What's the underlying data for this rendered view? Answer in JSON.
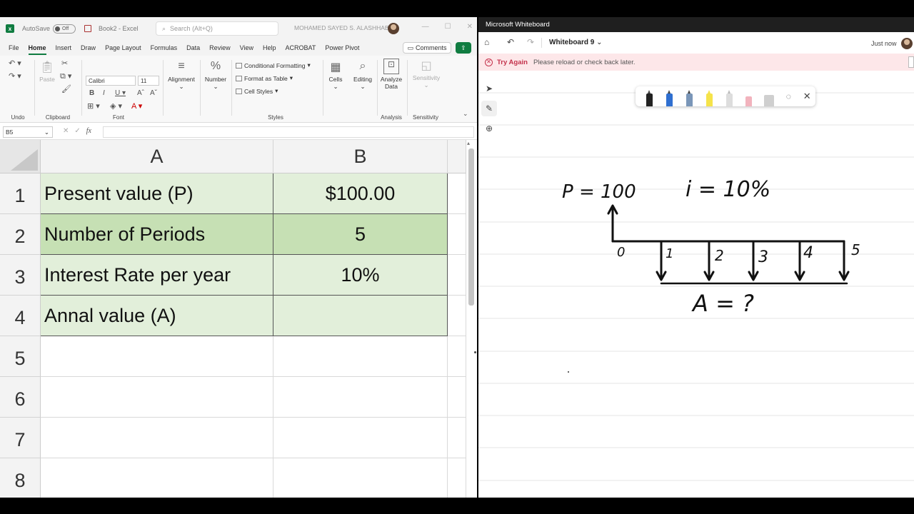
{
  "excel": {
    "autosave_label": "AutoSave",
    "autosave_state": "Off",
    "filename": "Book2  -  Excel",
    "search_placeholder": "Search (Alt+Q)",
    "user_name": "MOHAMED SAYED S. ALASHHAB",
    "tabs": [
      "File",
      "Home",
      "Insert",
      "Draw",
      "Page Layout",
      "Formulas",
      "Data",
      "Review",
      "View",
      "Help",
      "ACROBAT",
      "Power Pivot"
    ],
    "active_tab": "Home",
    "comments_label": "Comments",
    "ribbon": {
      "undo_label": "Undo",
      "paste_label": "Paste",
      "clipboard_label": "Clipboard",
      "font_name": "Calibri",
      "font_size": "11",
      "font_label": "Font",
      "alignment_label": "Alignment",
      "number_label": "Number",
      "conditional_formatting": "Conditional Formatting",
      "format_as_table": "Format as Table",
      "cell_styles": "Cell Styles",
      "styles_label": "Styles",
      "cells_label": "Cells",
      "editing_label": "Editing",
      "analyze_data_line1": "Analyze",
      "analyze_data_line2": "Data",
      "analysis_label": "Analysis",
      "sensitivity_btn": "Sensitivity",
      "sensitivity_label": "Sensitivity"
    },
    "name_box": "B5",
    "columns": [
      "A",
      "B"
    ],
    "rows": [
      "1",
      "2",
      "3",
      "4",
      "5",
      "6",
      "7",
      "8"
    ],
    "cells": [
      {
        "a": "Present value (P)",
        "b": "$100.00"
      },
      {
        "a": "Number of Periods",
        "b": "5"
      },
      {
        "a": "Interest Rate per year",
        "b": "10%"
      },
      {
        "a": "Annal value (A)",
        "b": ""
      }
    ],
    "colors": {
      "accent": "#107c41",
      "fill_light": "#e2efda",
      "fill_dark": "#c6e0b4"
    }
  },
  "whiteboard": {
    "app_title": "Microsoft Whiteboard",
    "board_name": "Whiteboard 9",
    "saved_status": "Just now",
    "error_title": "Try Again",
    "error_message": "Please reload or check back later.",
    "sketch": {
      "p_label": "P = 100",
      "i_label": "i = 10%",
      "a_label": "A = ?",
      "period_labels": [
        "0",
        "1",
        "2",
        "3",
        "4",
        "5"
      ]
    }
  }
}
